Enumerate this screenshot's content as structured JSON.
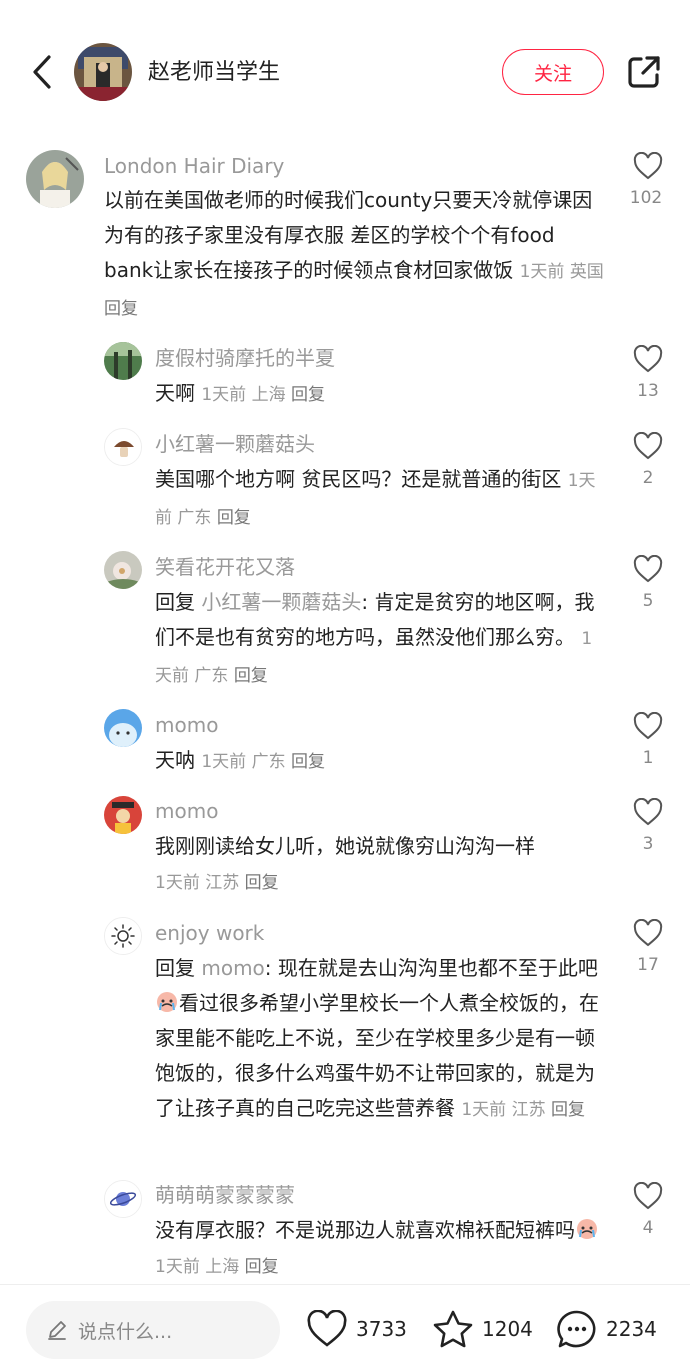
{
  "header": {
    "back_icon": "chevron-left-icon",
    "author_name": "赵老师当学生",
    "follow_label": "关注",
    "share_icon": "share-external-icon"
  },
  "comments": [
    {
      "name": "London Hair Diary",
      "text": "以前在美国做老师的时候我们county只要天冷就停课因为有的孩子家里没有厚衣服 差区的学校个个有food bank让家长在接孩子的时候领点食材回家做饭",
      "time": "1天前",
      "location": "英国",
      "reply": "回复",
      "likes": "102"
    },
    {
      "name": "度假村骑摩托的半夏",
      "text": "天啊",
      "time": "1天前",
      "location": "上海",
      "reply": "回复",
      "likes": "13"
    },
    {
      "name": "小红薯一颗蘑菇头",
      "text": "美国哪个地方啊 贫民区吗？还是就普通的街区",
      "time": "1天前",
      "location": "广东",
      "reply": "回复",
      "likes": "2"
    },
    {
      "name": "笑看花开花又落",
      "reply_prefix": "回复",
      "mention": "小红薯一颗蘑菇头",
      "text": ": 肯定是贫穷的地区啊，我们不是也有贫穷的地方吗，虽然没他们那么穷。",
      "time": "1天前",
      "location": "广东",
      "reply": "回复",
      "likes": "5"
    },
    {
      "name": "momo",
      "text": "天呐",
      "time": "1天前",
      "location": "广东",
      "reply": "回复",
      "likes": "1"
    },
    {
      "name": "momo",
      "text": "我刚刚读给女儿听，她说就像穷山沟沟一样",
      "time": "1天前",
      "location": "江苏",
      "reply": "回复",
      "likes": "3"
    },
    {
      "name": "enjoy work",
      "reply_prefix": "回复",
      "mention": "momo",
      "text_a": ": 现在就是去山沟沟里也都不至于此吧",
      "text_b": "看过很多希望小学里校长一个人煮全校饭的，在家里能不能吃上不说，至少在学校里多少是有一顿饱饭的，很多什么鸡蛋牛奶不让带回家的，就是为了让孩子真的自己吃完这些营养餐",
      "emoji": "crying-face-emoji",
      "time": "1天前",
      "location": "江苏",
      "reply": "回复",
      "likes": "17"
    },
    {
      "name": "萌萌萌蒙蒙蒙蒙",
      "text": "没有厚衣服？不是说那边人就喜欢棉袄配短裤吗",
      "emoji": "crying-face-emoji",
      "time": "1天前",
      "location": "上海",
      "reply": "回复",
      "likes": "4"
    }
  ],
  "bottom_bar": {
    "input_placeholder": "说点什么...",
    "like_count": "3733",
    "collect_count": "1204",
    "comment_count": "2234"
  },
  "colors": {
    "accent": "#ff2442",
    "meta_text": "#999999",
    "body_text": "#222222"
  }
}
